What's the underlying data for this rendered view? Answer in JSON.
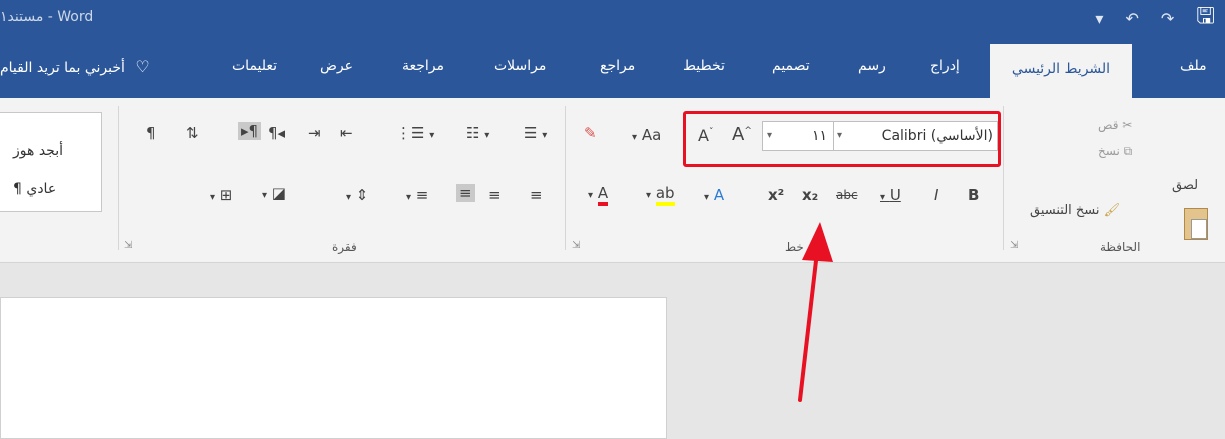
{
  "window": {
    "title": "مستند١ - Word"
  },
  "qat": {
    "save_glyph": "🖫",
    "redo_glyph": "↷",
    "undo_glyph": "↶",
    "customize_glyph": "▾"
  },
  "tabs": [
    {
      "label": "ملف"
    },
    {
      "label": "الشريط الرئيسي"
    },
    {
      "label": "إدراج"
    },
    {
      "label": "رسم"
    },
    {
      "label": "تصميم"
    },
    {
      "label": "تخطيط"
    },
    {
      "label": "مراجع"
    },
    {
      "label": "مراسلات"
    },
    {
      "label": "مراجعة"
    },
    {
      "label": "عرض"
    },
    {
      "label": "تعليمات"
    }
  ],
  "tell_me": {
    "label": "أخبرني بما تريد القيام",
    "icon": "lightbulb-icon"
  },
  "clipboard": {
    "label": "الحافظة",
    "paste": "لصق",
    "cut": "قص",
    "copy": "نسخ",
    "format_painter": "نسخ التنسيق"
  },
  "font": {
    "label": "خط",
    "font_name": "Calibri (الأساسي)",
    "font_size": "١١",
    "grow": "A",
    "shrink": "A",
    "change_case": "Aa",
    "bold": "B",
    "italic": "I",
    "underline": "U",
    "strike": "abc",
    "subscript": "x₂",
    "superscript": "x²",
    "text_effects": "A",
    "highlight": "ab",
    "font_color": "A"
  },
  "paragraph": {
    "label": "فقرة"
  },
  "styles": {
    "items": [
      "أبجد هوز",
      "¶ عادي"
    ]
  },
  "colors": {
    "accent": "#2b579a",
    "red": "#e81123",
    "highlight": "#ffff00"
  }
}
